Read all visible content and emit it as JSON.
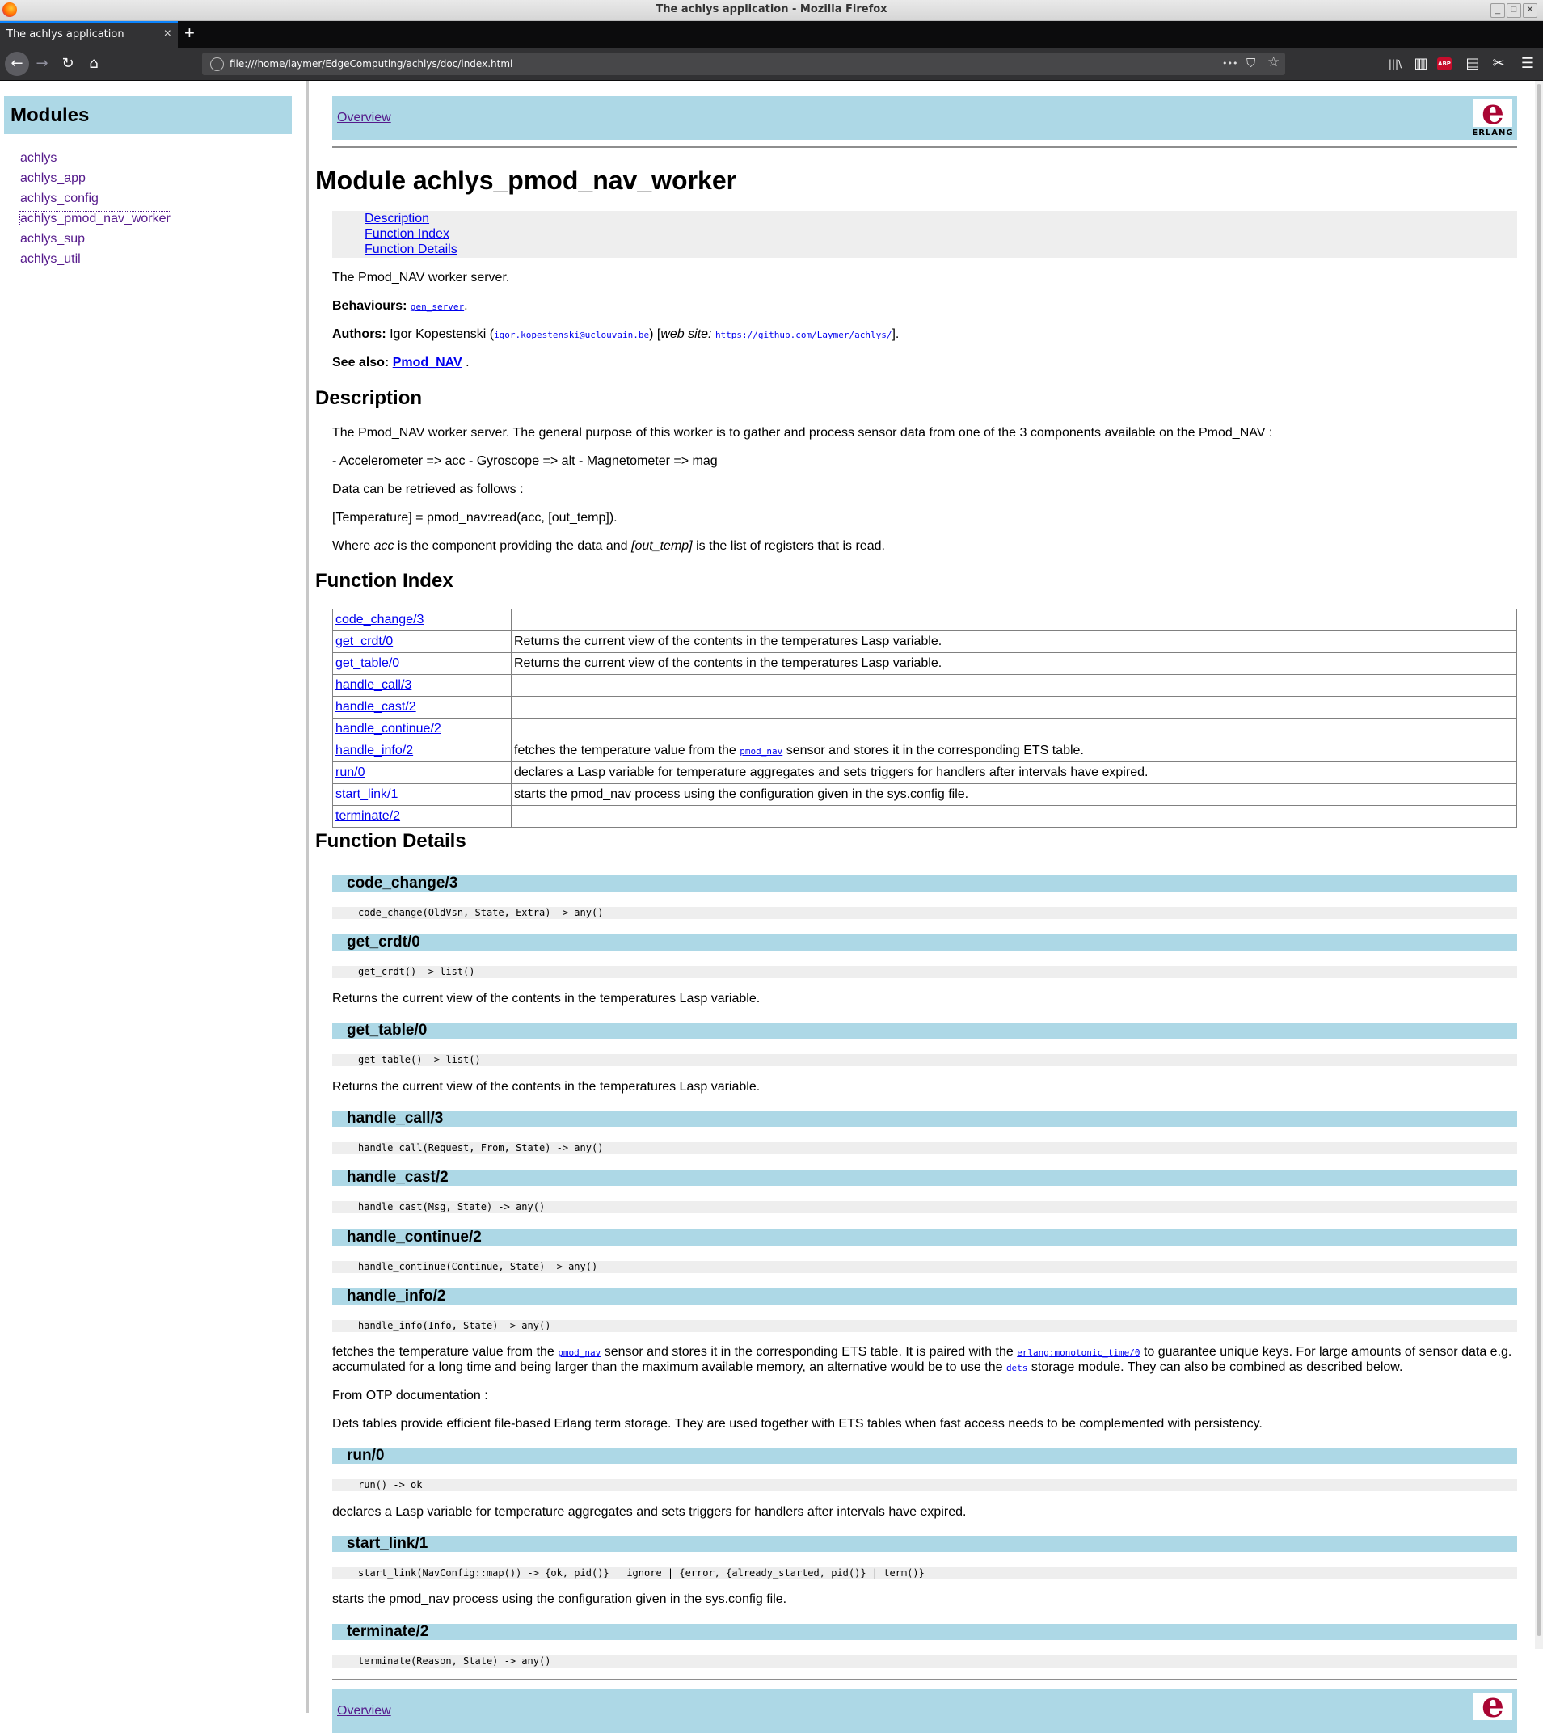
{
  "window": {
    "title": "The achlys application - Mozilla Firefox",
    "min_glyph": "_",
    "max_glyph": "□",
    "close_glyph": "✕"
  },
  "tabs": [
    {
      "label": "The achlys application",
      "close_glyph": "×"
    }
  ],
  "toolbar": {
    "new_tab_glyph": "+",
    "back_glyph": "←",
    "forward_glyph": "→",
    "reload_glyph": "↻",
    "home_glyph": "⌂",
    "url": "file:///home/laymer/EdgeComputing/achlys/doc/index.html",
    "info_glyph": "i",
    "more_glyph": "•••",
    "pocket_glyph": "⛉",
    "star_glyph": "☆",
    "library_glyph": "|||\\",
    "sidebar_glyph": "▥",
    "abp_label": "ABP",
    "reader_glyph": "▤",
    "screenshot_glyph": "✂",
    "menu_glyph": "☰"
  },
  "left": {
    "heading": "Modules",
    "modules": [
      "achlys",
      "achlys_app",
      "achlys_config",
      "achlys_pmod_nav_worker",
      "achlys_sup",
      "achlys_util"
    ],
    "selected": "achlys_pmod_nav_worker"
  },
  "main": {
    "navbar_link": "Overview",
    "logo_word": "ERLANG",
    "logo_letter": "e",
    "title": "Module achlys_pmod_nav_worker",
    "toc": [
      "Description",
      "Function Index",
      "Function Details"
    ],
    "summary": "The Pmod_NAV worker server.",
    "behaviours_label": "Behaviours:",
    "behaviours_link": "gen_server",
    "behaviours_suffix": ".",
    "authors_label": "Authors:",
    "author_name": "Igor Kopestenski (",
    "author_email": "igor.kopestenski@uclouvain.be",
    "author_mid": ") [",
    "author_website_label": "web site:",
    "author_url": "https://github.com/Laymer/achlys/",
    "author_end": "].",
    "see_also_label": "See also:",
    "see_also_link": "Pmod_NAV",
    "see_also_suffix": ".",
    "description_heading": "Description",
    "description": [
      "The Pmod_NAV worker server. The general purpose of this worker is to gather and process sensor data from one of the 3 components available on the Pmod_NAV :",
      "- Accelerometer => acc - Gyroscope => alt - Magnetometer => mag",
      "Data can be retrieved as follows :",
      "[Temperature] = pmod_nav:read(acc, [out_temp])."
    ],
    "desc_where_1": "Where ",
    "desc_where_acc": "acc",
    "desc_where_2": " is the component providing the data and ",
    "desc_where_out": "[out_temp]",
    "desc_where_3": " is the list of registers that is read.",
    "index_heading": "Function Index",
    "function_index": [
      {
        "name": "code_change/3",
        "desc": ""
      },
      {
        "name": "get_crdt/0",
        "desc": "Returns the current view of the contents in the temperatures Lasp variable."
      },
      {
        "name": "get_table/0",
        "desc": "Returns the current view of the contents in the temperatures Lasp variable."
      },
      {
        "name": "handle_call/3",
        "desc": ""
      },
      {
        "name": "handle_cast/2",
        "desc": ""
      },
      {
        "name": "handle_continue/2",
        "desc": ""
      },
      {
        "name": "handle_info/2",
        "desc_pre": "fetches the temperature value from the ",
        "desc_link": "pmod_nav",
        "desc_post": " sensor and stores it in the corresponding ETS table."
      },
      {
        "name": "run/0",
        "desc": "declares a Lasp variable for temperature aggregates and sets triggers for handlers after intervals have expired."
      },
      {
        "name": "start_link/1",
        "desc": "starts the pmod_nav process using the configuration given in the sys.config file."
      },
      {
        "name": "terminate/2",
        "desc": ""
      }
    ],
    "details_heading": "Function Details",
    "details": [
      {
        "name": "code_change/3",
        "spec": "code_change(OldVsn, State, Extra) -> any()"
      },
      {
        "name": "get_crdt/0",
        "spec": "get_crdt() -> list()",
        "text": "Returns the current view of the contents in the temperatures Lasp variable."
      },
      {
        "name": "get_table/0",
        "spec": "get_table() -> list()",
        "text": "Returns the current view of the contents in the temperatures Lasp variable."
      },
      {
        "name": "handle_call/3",
        "spec": "handle_call(Request, From, State) -> any()"
      },
      {
        "name": "handle_cast/2",
        "spec": "handle_cast(Msg, State) -> any()"
      },
      {
        "name": "handle_continue/2",
        "spec": "handle_continue(Continue, State) -> any()"
      },
      {
        "name": "handle_info/2",
        "spec": "handle_info(Info, State) -> any()"
      },
      {
        "name": "run/0",
        "spec": "run() -> ok",
        "text": "declares a Lasp variable for temperature aggregates and sets triggers for handlers after intervals have expired."
      },
      {
        "name": "start_link/1",
        "spec": "start_link(NavConfig::map()) -> {ok, pid()} | ignore | {error, {already_started, pid()} | term()}",
        "text": "starts the pmod_nav process using the configuration given in the sys.config file."
      },
      {
        "name": "terminate/2",
        "spec": "terminate(Reason, State) -> any()"
      }
    ],
    "handle_info_text": {
      "l1_a": "fetches the temperature value from the ",
      "l1_link1": "pmod_nav",
      "l1_b": " sensor and stores it in the corresponding ETS table. It is paired with the ",
      "l1_link2": "erlang:monotonic_time/0",
      "l1_c": " to guarantee unique keys. For large amounts of sensor data e.g.",
      "l2_a": "accumulated for a long time and being larger than the maximum available memory, an alternative would be to use the ",
      "l2_link": "dets",
      "l2_b": " storage module. They can also be combined as described below.",
      "otp": "From OTP documentation :",
      "dets": "Dets tables provide efficient file-based Erlang term storage. They are used together with ETS tables when fast access needs to be complemented with persistency."
    }
  }
}
